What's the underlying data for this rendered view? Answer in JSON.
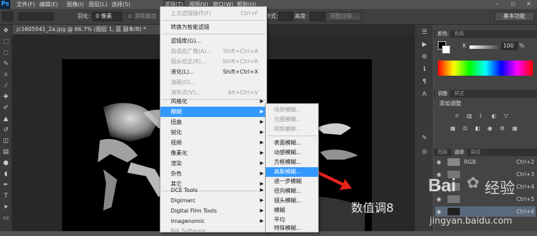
{
  "app": {
    "logo": "Ps"
  },
  "menubar": {
    "items": [
      "文件(F)",
      "编辑(E)",
      "图像(I)",
      "图层(L)",
      "选择(S)",
      "滤镜(T)",
      "视图(V)",
      "窗口(W)",
      "帮助(H)"
    ],
    "active": "滤镜(T)"
  },
  "options": {
    "feather_label": "羽化:",
    "feather_value": "0 像素",
    "antialias": "消除锯齿",
    "style_label": "样式:",
    "height_label": "高度:",
    "refine_button": "调整边缘...",
    "workspace": "基本功能"
  },
  "document": {
    "tab_title": "jc1605041_2a.jpg @ 66.7% (图层 1, 蓝 副本/8) *",
    "close_glyph": "×"
  },
  "filter_menu": {
    "items": [
      {
        "label": "上次滤镜操作(F)",
        "shortcut": "Ctrl+F",
        "disabled": true
      },
      {
        "label": "转换为智能滤镜",
        "shortcut": "",
        "disabled": false
      },
      {
        "label": "滤镜库(G)...",
        "shortcut": "",
        "disabled": false
      },
      {
        "label": "自适应广角(A)...",
        "shortcut": "Shift+Ctrl+A",
        "disabled": true
      },
      {
        "label": "镜头校正(R)...",
        "shortcut": "Shift+Ctrl+R",
        "disabled": true
      },
      {
        "label": "液化(L)...",
        "shortcut": "Shift+Ctrl+X",
        "disabled": false
      },
      {
        "label": "油画(O)...",
        "shortcut": "",
        "disabled": true
      },
      {
        "label": "消失点(V)...",
        "shortcut": "Alt+Ctrl+V",
        "disabled": true
      },
      {
        "label": "风格化",
        "submenu": true
      },
      {
        "label": "模糊",
        "submenu": true,
        "highlighted": true
      },
      {
        "label": "扭曲",
        "submenu": true
      },
      {
        "label": "锐化",
        "submenu": true
      },
      {
        "label": "视频",
        "submenu": true
      },
      {
        "label": "像素化",
        "submenu": true
      },
      {
        "label": "渲染",
        "submenu": true
      },
      {
        "label": "杂色",
        "submenu": true
      },
      {
        "label": "其它",
        "submenu": true
      },
      {
        "label": "DCE Tools",
        "submenu": true
      },
      {
        "label": "Digimarc",
        "submenu": true
      },
      {
        "label": "Digital Film Tools",
        "submenu": true
      },
      {
        "label": "Imagenomic",
        "submenu": true
      },
      {
        "label": "Nik Software",
        "submenu": true
      }
    ]
  },
  "blur_menu": {
    "items": [
      {
        "label": "场景模糊...",
        "disabled": true
      },
      {
        "label": "光圈模糊...",
        "disabled": true
      },
      {
        "label": "倾斜偏移...",
        "disabled": true
      },
      {
        "label": "表面模糊...",
        "disabled": false
      },
      {
        "label": "动感模糊...",
        "disabled": false
      },
      {
        "label": "方框模糊...",
        "disabled": false
      },
      {
        "label": "高斯模糊...",
        "disabled": false,
        "highlighted": true
      },
      {
        "label": "进一步模糊",
        "disabled": false
      },
      {
        "label": "径向模糊...",
        "disabled": false
      },
      {
        "label": "镜头模糊...",
        "disabled": false
      },
      {
        "label": "模糊",
        "disabled": false
      },
      {
        "label": "平均",
        "disabled": false
      },
      {
        "label": "特殊模糊...",
        "disabled": false
      }
    ]
  },
  "color_panel": {
    "tabs": [
      "颜色",
      "色板"
    ],
    "channel": "K",
    "value": "100",
    "unit": "%"
  },
  "adjust_panel": {
    "tabs": [
      "调整",
      "样式"
    ],
    "title": "添加调整"
  },
  "layers_panel": {
    "tabs": [
      "图层",
      "通道",
      "路径"
    ],
    "channels": [
      {
        "name": "RGB",
        "shortcut": "Ctrl+2"
      },
      {
        "name": "",
        "shortcut": "Ctrl+3"
      },
      {
        "name": "",
        "shortcut": "Ctrl+4"
      },
      {
        "name": "",
        "shortcut": "Ctrl+5"
      },
      {
        "name": "",
        "shortcut": "Ctrl+6"
      }
    ]
  },
  "overlay": {
    "caption": "数值调8",
    "watermark_brand": "Bai",
    "watermark_cn": "经验",
    "watermark_url": "jingyan.baidu.com",
    "arrow_color": "#e8231c"
  }
}
